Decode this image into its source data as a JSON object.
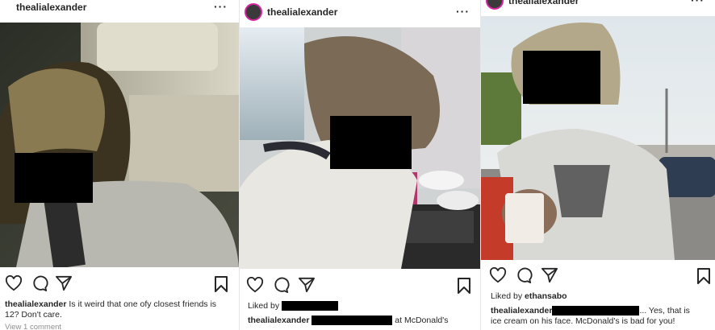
{
  "posts": [
    {
      "username": "thealialexander",
      "more_label": "···",
      "caption_user": "thealialexander",
      "caption_text": "Is it weird that one ofy closest friends is 12? Don't care.",
      "view_comments": "View 1 comment"
    },
    {
      "username": "thealialexander",
      "more_label": "···",
      "liked_by_label": "Liked by",
      "caption_user": "thealialexander",
      "caption_text": "at McDonald's"
    },
    {
      "username": "thealialexander",
      "more_label": "···",
      "liked_by_label": "Liked by",
      "liked_by_user": "ethansabo",
      "caption_user": "thealialexander",
      "caption_text_1": "... Yes, that is",
      "caption_text_2": "ice cream on his face. McDonald's is bad for you!"
    }
  ],
  "icons": [
    "more-icon",
    "heart-icon",
    "comment-icon",
    "share-icon",
    "bookmark-icon"
  ],
  "colors": {
    "text": "#262626",
    "story_ring": "#d6249f",
    "redaction": "#000000",
    "muted": "#8e8e8e"
  }
}
